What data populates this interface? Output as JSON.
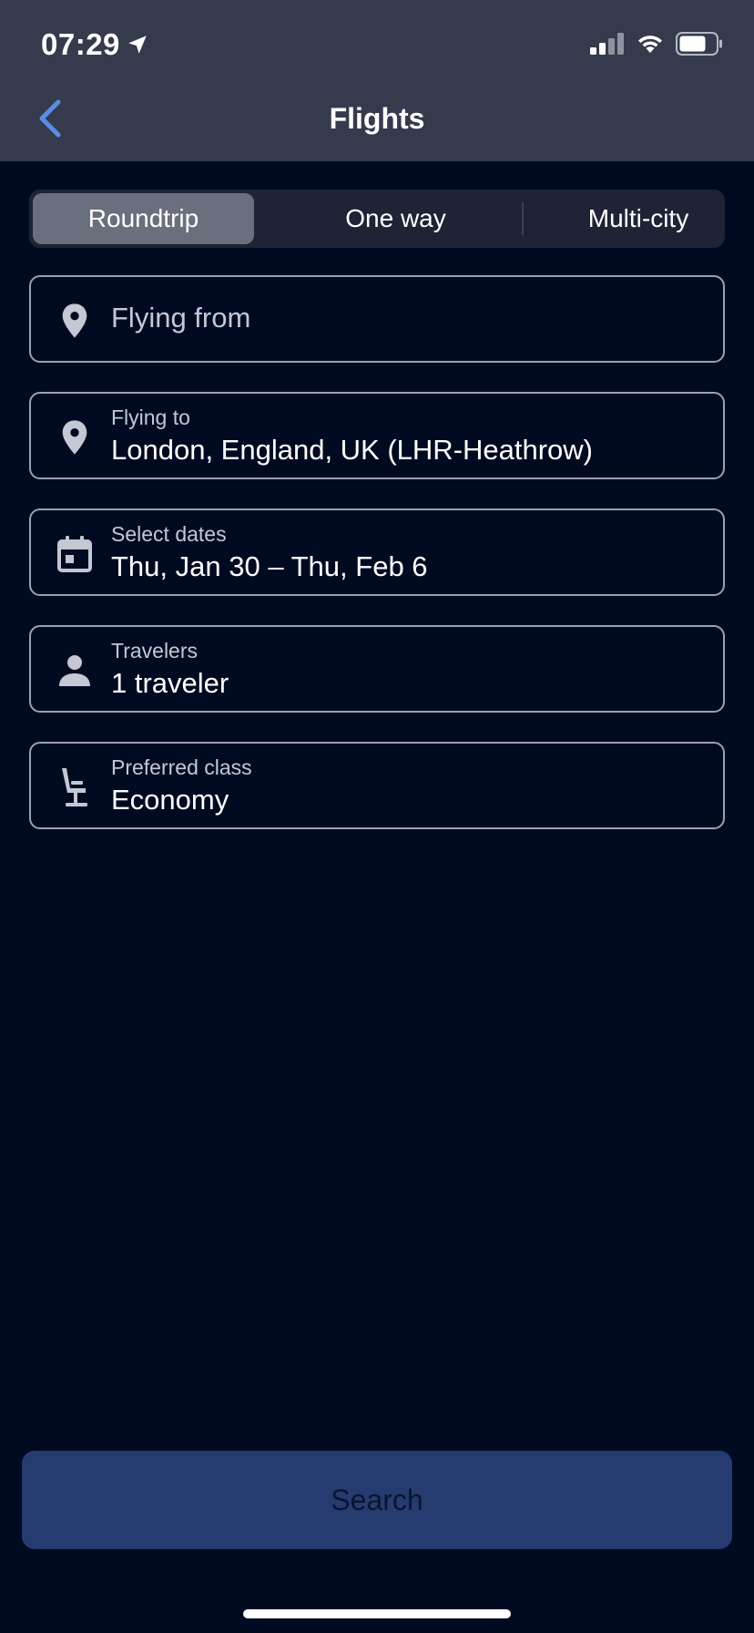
{
  "status_bar": {
    "time": "07:29",
    "icons": [
      "location-arrow-icon",
      "cellular-signal-icon",
      "wifi-icon",
      "battery-icon"
    ]
  },
  "nav": {
    "title": "Flights",
    "back_icon": "chevron-left-icon"
  },
  "trip_types": {
    "options": [
      "Roundtrip",
      "One way",
      "Multi-city"
    ],
    "selected": "Roundtrip"
  },
  "form": {
    "origin": {
      "placeholder": "Flying from",
      "icon": "map-pin-icon"
    },
    "destination": {
      "label": "Flying to",
      "value": "London, England, UK (LHR-Heathrow)",
      "icon": "map-pin-icon"
    },
    "dates": {
      "label": "Select dates",
      "value": "Thu, Jan 30 – Thu, Feb 6",
      "icon": "calendar-icon"
    },
    "travelers": {
      "label": "Travelers",
      "value": "1 traveler",
      "icon": "person-icon"
    },
    "class": {
      "label": "Preferred class",
      "value": "Economy",
      "icon": "seat-icon"
    }
  },
  "search_button": {
    "label": "Search"
  },
  "colors": {
    "background": "#000b22",
    "header": "#353b4d",
    "accent": "#5a8de8",
    "button": "#263b6f"
  }
}
